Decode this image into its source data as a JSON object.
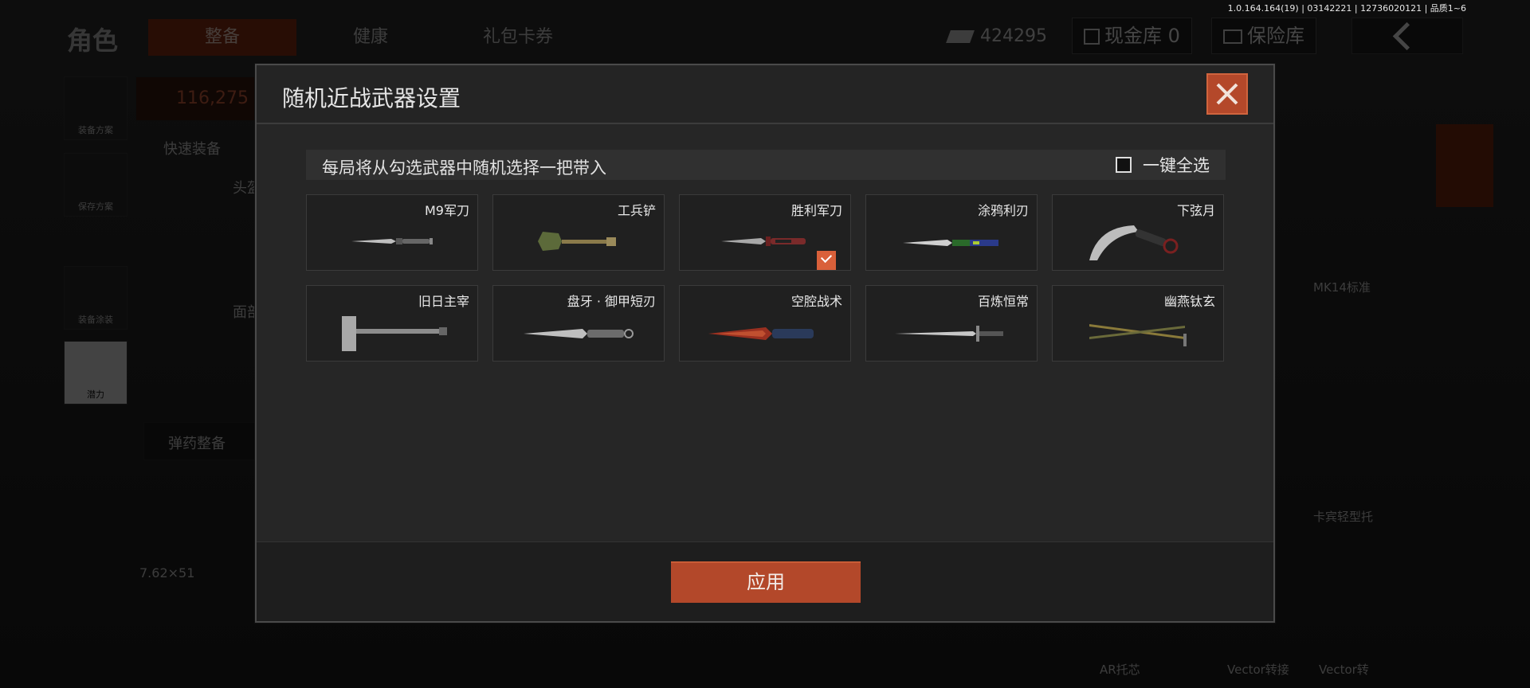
{
  "version_info": "1.0.164.164(19) | 03142221 | 12736020121 | 品质1~6",
  "background": {
    "section_title": "角色",
    "tabs": [
      {
        "label": "整备",
        "active": true
      },
      {
        "label": "健康",
        "active": false
      },
      {
        "label": "礼包卡券",
        "active": false
      }
    ],
    "currency_value": "424295",
    "vault_label": "现金库 0",
    "safe_label": "保险库",
    "left_nav": [
      {
        "label": "装备方案"
      },
      {
        "label": "保存方案"
      },
      {
        "label": "装备涂装"
      },
      {
        "label": "潜力"
      }
    ],
    "value_text": "116,275",
    "quick_equip": "快速装备",
    "head_label": "头盔",
    "face_label": "面部",
    "ammo_label": "弹药整备",
    "ammo_caliber": "7.62×51",
    "right_labels": [
      "MK14标准",
      "卡宾轻型托",
      "AR托芯",
      "Vector转接",
      "Vector转"
    ]
  },
  "modal": {
    "title": "随机近战武器设置",
    "info_text": "每局将从勾选武器中随机选择一把带入",
    "select_all_label": "一键全选",
    "weapons": [
      {
        "name": "M9军刀",
        "icon": "knife-icon",
        "selected": false
      },
      {
        "name": "工兵铲",
        "icon": "shovel-icon",
        "selected": false
      },
      {
        "name": "胜利军刀",
        "icon": "knife-icon",
        "selected": true
      },
      {
        "name": "涂鸦利刃",
        "icon": "butterfly-knife-icon",
        "selected": false
      },
      {
        "name": "下弦月",
        "icon": "karambit-icon",
        "selected": false
      },
      {
        "name": "旧日主宰",
        "icon": "hammer-icon",
        "selected": false
      },
      {
        "name": "盘牙 · 御甲短刃",
        "icon": "dagger-icon",
        "selected": false
      },
      {
        "name": "空腔战术",
        "icon": "tactical-knife-icon",
        "selected": false
      },
      {
        "name": "百炼恒常",
        "icon": "sword-icon",
        "selected": false
      },
      {
        "name": "幽燕钛玄",
        "icon": "twin-blade-icon",
        "selected": false
      }
    ],
    "apply_label": "应用"
  },
  "colors": {
    "accent": "#b4482a",
    "check": "#d9603a",
    "panel": "#262626"
  }
}
